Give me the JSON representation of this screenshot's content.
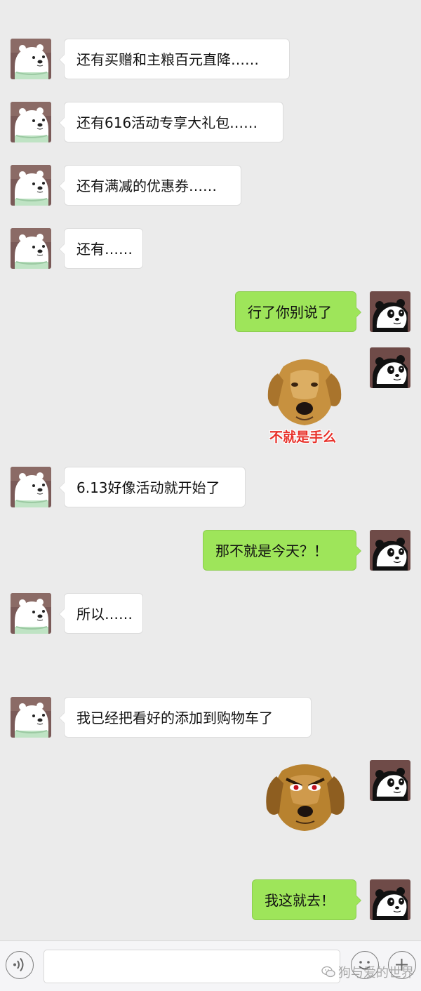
{
  "chat": {
    "messages": [
      {
        "side": "left",
        "type": "text",
        "text": "还有买赠和主粮百元直降……"
      },
      {
        "side": "left",
        "type": "text",
        "text": "还有616活动专享大礼包……"
      },
      {
        "side": "left",
        "type": "text",
        "text": "还有满减的优惠券……"
      },
      {
        "side": "left",
        "type": "text",
        "text": "还有……"
      },
      {
        "side": "right",
        "type": "text",
        "text": "行了你别说了"
      },
      {
        "side": "right",
        "type": "sticker",
        "sticker": "golden-retriever-sticker",
        "caption": "不就是手么"
      },
      {
        "side": "left",
        "type": "text",
        "text": "6.13好像活动就开始了"
      },
      {
        "side": "right",
        "type": "text",
        "text": "那不就是今天？！"
      },
      {
        "side": "left",
        "type": "text",
        "text": "所以……"
      },
      {
        "side": "left",
        "type": "text",
        "text": "我已经把看好的添加到购物车了"
      },
      {
        "side": "right",
        "type": "sticker",
        "sticker": "angry-dog-sticker",
        "caption": ""
      },
      {
        "side": "right",
        "type": "text",
        "text": "我这就去！"
      }
    ]
  },
  "avatars": {
    "left": "ice-bear-avatar",
    "right": "panda-avatar"
  },
  "input_bar": {
    "voice_button_icon": "voice-icon",
    "input_value": "",
    "emoji_button_icon": "emoji-icon",
    "more_button_icon": "plus-icon"
  },
  "watermark": {
    "text": "狗与爱的世界",
    "icon": "wechat-icon"
  },
  "colors": {
    "background": "#ebebeb",
    "incoming_bubble": "#ffffff",
    "outgoing_bubble": "#9ee55a",
    "sticker_caption": "#e8322b"
  }
}
